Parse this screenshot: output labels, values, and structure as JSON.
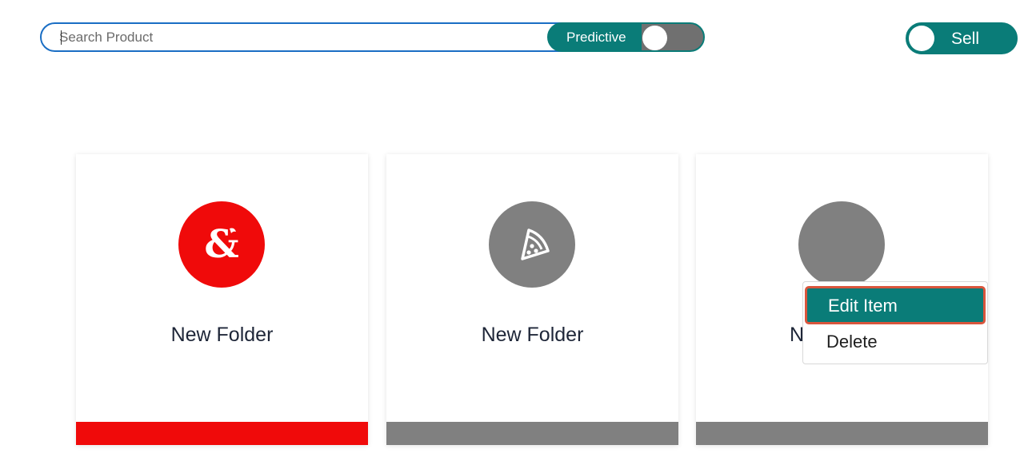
{
  "search": {
    "placeholder": "Search Product",
    "predictive_label": "Predictive"
  },
  "sell_toggle": {
    "label": "Sell"
  },
  "cards": [
    {
      "title": "New Folder",
      "icon": "dragon-ampersand-icon",
      "color": "#f00a0a"
    },
    {
      "title": "New Folder",
      "icon": "pizza-slice-icon",
      "color": "#808080"
    },
    {
      "title": "N",
      "icon": "blank-circle-icon",
      "color": "#808080"
    }
  ],
  "context_menu": {
    "items": [
      "Edit Item",
      "Delete"
    ]
  },
  "colors": {
    "accent": "#0a7c78",
    "search_border": "#1a6ec4",
    "highlight_outline": "#d9553c"
  }
}
